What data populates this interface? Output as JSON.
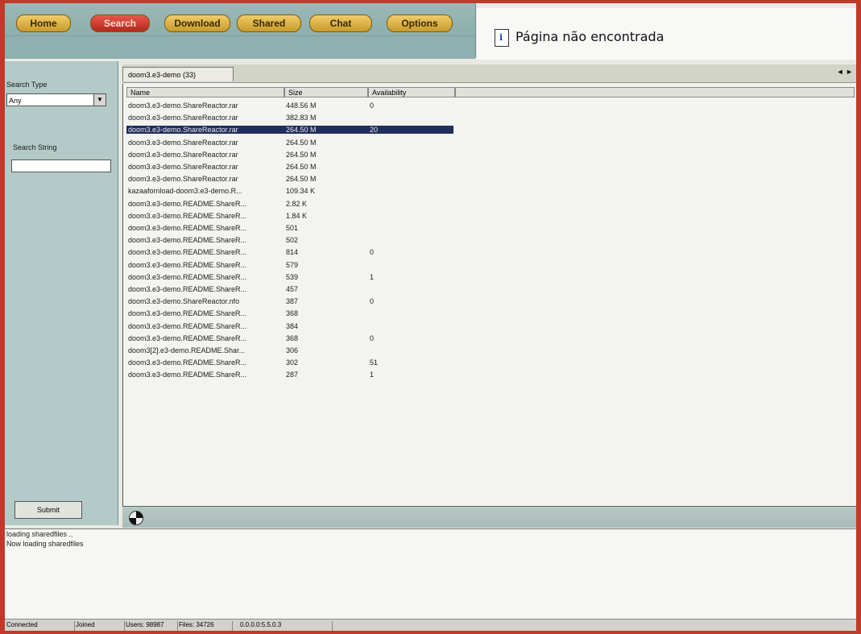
{
  "nav": {
    "items": [
      {
        "label": "Home"
      },
      {
        "label": "Search"
      },
      {
        "label": "Download"
      },
      {
        "label": "Shared"
      },
      {
        "label": "Chat"
      },
      {
        "label": "Options"
      }
    ],
    "active": "Search"
  },
  "notfound": {
    "text": "Página não encontrada"
  },
  "search": {
    "type_label": "Search Type",
    "type_value": "Any",
    "string_label": "Search String",
    "string_value": "",
    "submit_label": "Submit"
  },
  "tab": {
    "label": "doom3.e3-demo (33)",
    "scroll": "◄ ►"
  },
  "columns": {
    "name": "Name",
    "size": "Size",
    "availability": "Availability"
  },
  "rows": [
    {
      "name": "doom3.e3-demo.ShareReactor.rar",
      "size": "448.56 M",
      "avail": "0"
    },
    {
      "name": "doom3.e3-demo.ShareReactor.rar",
      "size": "382.83 M",
      "avail": ""
    },
    {
      "name": "doom3.e3-demo.ShareReactor.rar",
      "size": "264.50 M",
      "avail": "20"
    },
    {
      "name": "doom3.e3-demo.ShareReactor.rar",
      "size": "264.50 M",
      "avail": ""
    },
    {
      "name": "doom3.e3-demo.ShareReactor.rar",
      "size": "264.50 M",
      "avail": ""
    },
    {
      "name": "doom3.e3-demo.ShareReactor.rar",
      "size": "264.50 M",
      "avail": ""
    },
    {
      "name": "doom3.e3-demo.ShareReactor.rar",
      "size": "264.50 M",
      "avail": ""
    },
    {
      "name": "kazaafornload-doom3.e3-demo.R...",
      "size": "109.34 K",
      "avail": ""
    },
    {
      "name": "doom3.e3-demo.README.ShareR...",
      "size": "2.82 K",
      "avail": ""
    },
    {
      "name": "doom3.e3-demo.README.ShareR...",
      "size": "1.84 K",
      "avail": ""
    },
    {
      "name": "doom3.e3-demo.README.ShareR...",
      "size": "501",
      "avail": ""
    },
    {
      "name": "doom3.e3-demo.README.ShareR...",
      "size": "502",
      "avail": ""
    },
    {
      "name": "doom3.e3-demo.README.ShareR...",
      "size": "814",
      "avail": "0"
    },
    {
      "name": "doom3.e3-demo.README.ShareR...",
      "size": "579",
      "avail": ""
    },
    {
      "name": "doom3.e3-demo.README.ShareR...",
      "size": "539",
      "avail": "1"
    },
    {
      "name": "doom3.e3-demo.README.ShareR...",
      "size": "457",
      "avail": ""
    },
    {
      "name": "doom3.e3-demo.ShareReactor.nfo",
      "size": "387",
      "avail": "0"
    },
    {
      "name": "doom3.e3-demo.README.ShareR...",
      "size": "368",
      "avail": ""
    },
    {
      "name": "doom3.e3-demo.README.ShareR...",
      "size": "384",
      "avail": ""
    },
    {
      "name": "doom3.e3-demo.README.ShareR...",
      "size": "368",
      "avail": "0"
    },
    {
      "name": "doom3[2].e3-demo.README.Shar...",
      "size": "306",
      "avail": ""
    },
    {
      "name": "doom3.e3-demo.README.ShareR...",
      "size": "302",
      "avail": "51"
    },
    {
      "name": "doom3.e3-demo.README.ShareR...",
      "size": "287",
      "avail": "1"
    }
  ],
  "log": [
    "loading sharedfiles ..",
    "Now loading sharedfiles"
  ],
  "status": {
    "connection": "Connected",
    "user": "Joined",
    "users": "Users: 98987",
    "files": "Files: 34726",
    "ip": "0.0.0.0:5.5.0.3"
  }
}
